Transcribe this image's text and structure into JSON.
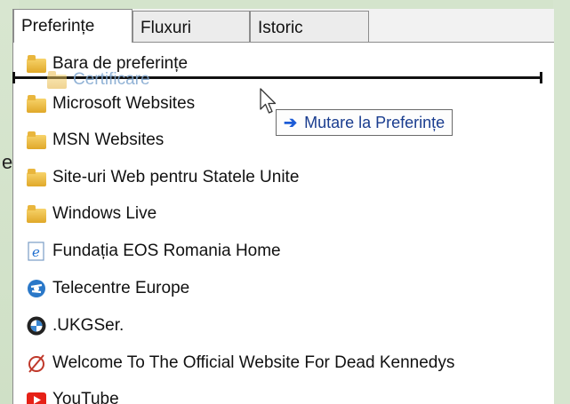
{
  "tabs": [
    {
      "label": "Preferințe",
      "active": true
    },
    {
      "label": "Fluxuri",
      "active": false
    },
    {
      "label": "Istoric",
      "active": false
    }
  ],
  "backdrop_char": "e",
  "drag": {
    "ghost_label": "Certificare",
    "tooltip_label": "Mutare la Preferințe",
    "tooltip_icon": "arrow-right-icon"
  },
  "items": [
    {
      "label": "Bara de preferințe",
      "icon": "folder-icon"
    },
    {
      "label": "Microsoft Websites",
      "icon": "folder-icon"
    },
    {
      "label": "MSN Websites",
      "icon": "folder-icon"
    },
    {
      "label": "Site-uri Web pentru Statele Unite",
      "icon": "folder-icon"
    },
    {
      "label": "Windows Live",
      "icon": "folder-icon"
    },
    {
      "label": "Fundația EOS Romania  Home",
      "icon": "ie-page-icon"
    },
    {
      "label": "Telecentre Europe",
      "icon": "globe-icon"
    },
    {
      "label": ".UKGSer.",
      "icon": "bmw-icon"
    },
    {
      "label": "Welcome To The Official Website For Dead Kennedys",
      "icon": "dk-logo-icon"
    },
    {
      "label": "YouTube",
      "icon": "youtube-icon"
    }
  ],
  "colors": {
    "accent": "#1c5bd6",
    "folder": "#e0a829",
    "backdrop": "#d4e4cc"
  }
}
